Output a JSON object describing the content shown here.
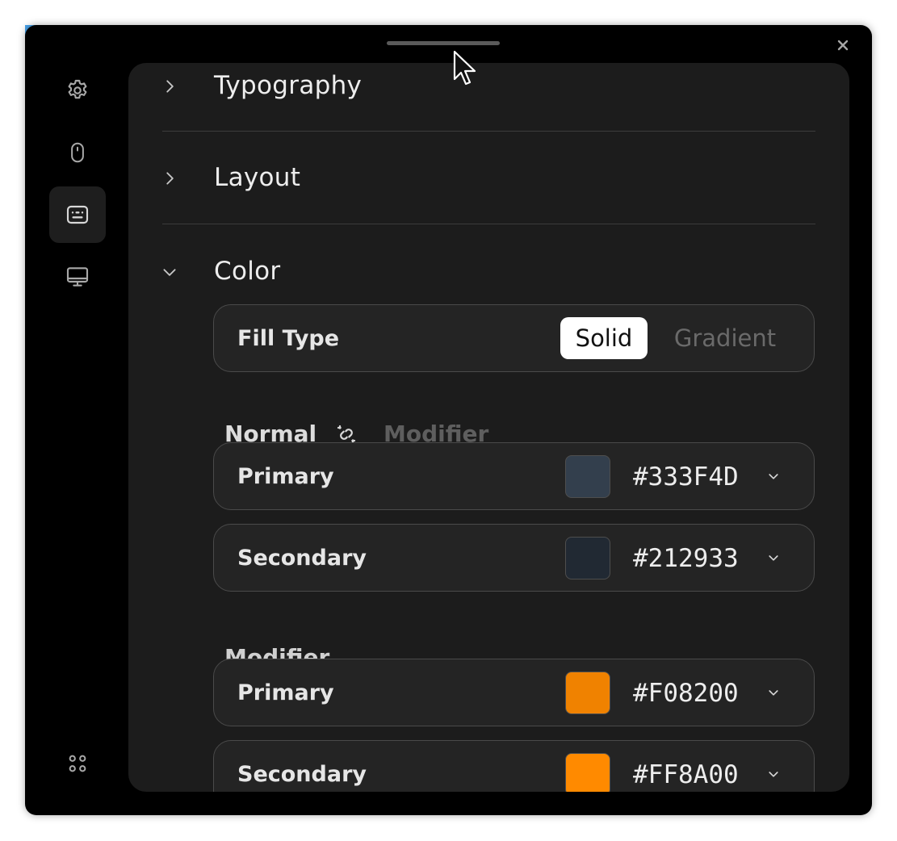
{
  "window": {
    "close_label": "×"
  },
  "sidebar": {
    "items": [
      {
        "name": "settings",
        "icon": "gear-icon",
        "active": false
      },
      {
        "name": "mouse",
        "icon": "mouse-icon",
        "active": false
      },
      {
        "name": "keyboard",
        "icon": "keyboard-icon",
        "active": true
      },
      {
        "name": "display",
        "icon": "monitor-icon",
        "active": false
      }
    ],
    "bottom_icon": "apps-grid-icon"
  },
  "sections": {
    "typography": {
      "title": "Typography",
      "expanded": false
    },
    "layout": {
      "title": "Layout",
      "expanded": false
    },
    "color": {
      "title": "Color",
      "expanded": true
    }
  },
  "fill_type": {
    "label": "Fill Type",
    "options": [
      "Solid",
      "Gradient"
    ],
    "selected": "Solid"
  },
  "state_toggle": {
    "normal_label": "Normal",
    "modifier_label": "Modifier",
    "link_icon": "unlink-icon"
  },
  "normal": {
    "primary": {
      "label": "Primary",
      "hex": "#333F4D",
      "color": "#333F4D"
    },
    "secondary": {
      "label": "Secondary",
      "hex": "#212933",
      "color": "#212933"
    }
  },
  "modifier": {
    "heading": "Modifier",
    "primary": {
      "label": "Primary",
      "hex": "#F08200",
      "color": "#F08200"
    },
    "secondary": {
      "label": "Secondary",
      "hex": "#FF8A00",
      "color": "#FF8A00"
    }
  }
}
